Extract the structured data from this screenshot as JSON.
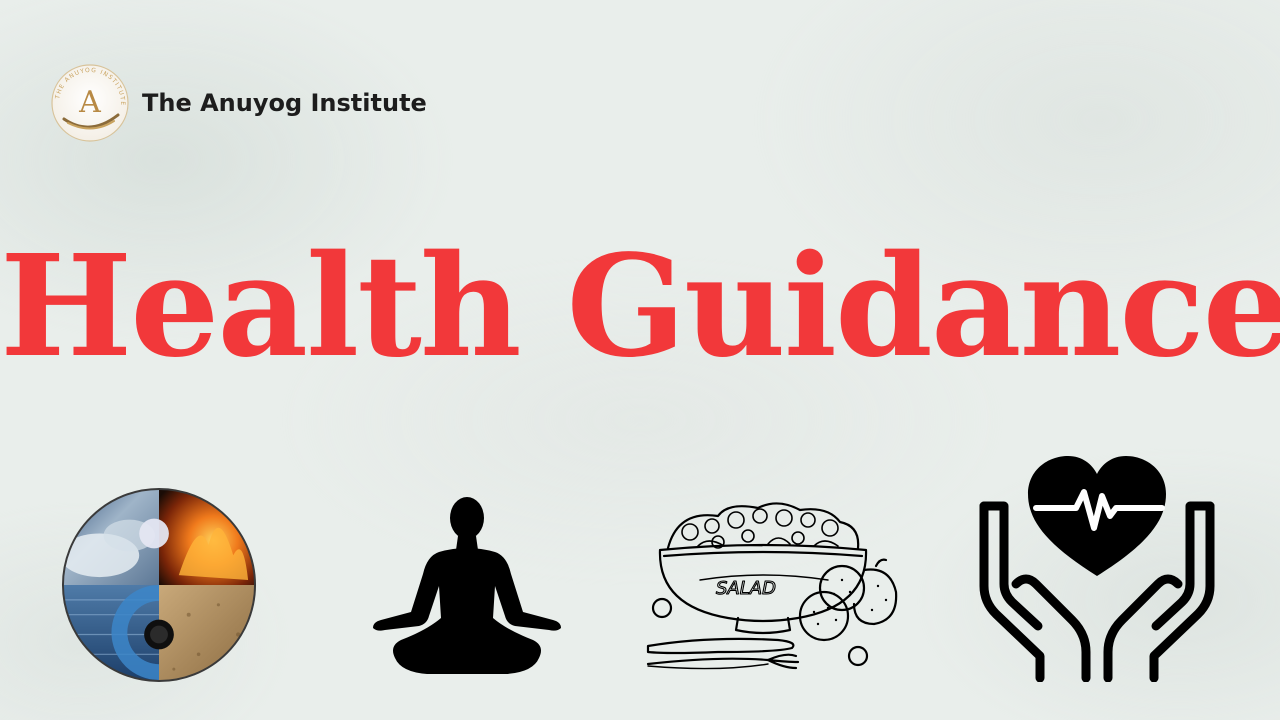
{
  "brand": {
    "name": "The Anuyog Institute",
    "logo_letter": "A",
    "logo_ring_text": "THE ANUYOG INSTITUTE",
    "logo_icon": "anuyog-logo-icon"
  },
  "title": "Health Guidance",
  "icons": [
    {
      "name": "five-elements-icon"
    },
    {
      "name": "meditation-icon"
    },
    {
      "name": "salad-icon"
    },
    {
      "name": "heart-in-hands-icon"
    }
  ],
  "colors": {
    "title": "#f2383a",
    "brand_text": "#1d1d1d",
    "background": "#e9eeeb",
    "logo_gold": "#c9a35f"
  }
}
